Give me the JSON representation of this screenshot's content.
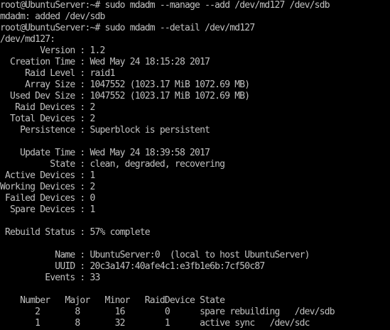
{
  "terminal": {
    "lines": [
      "root@UbuntuServer:~# sudo mdadm --manage --add /dev/md127 /dev/sdb",
      "mdadm: added /dev/sdb",
      "root@UbuntuServer:~# sudo mdadm --detail /dev/md127",
      "/dev/md127:",
      "        Version : 1.2",
      "  Creation Time : Wed May 24 18:15:28 2017",
      "     Raid Level : raid1",
      "     Array Size : 1047552 (1023.17 MiB 1072.69 MB)",
      "  Used Dev Size : 1047552 (1023.17 MiB 1072.69 MB)",
      "   Raid Devices : 2",
      "  Total Devices : 2",
      "    Persistence : Superblock is persistent",
      "",
      "    Update Time : Wed May 24 18:39:58 2017",
      "          State : clean, degraded, recovering",
      " Active Devices : 1",
      "Working Devices : 2",
      " Failed Devices : 0",
      "  Spare Devices : 1",
      "",
      " Rebuild Status : 57% complete",
      "",
      "           Name : UbuntuServer:0  (local to host UbuntuServer)",
      "           UUID : 20c3a147:40afe4c1:e3fb1e6b:7cf50c87",
      "         Events : 33",
      "",
      "    Number   Major   Minor   RaidDevice State",
      "       2       8       16        0      spare rebuilding   /dev/sdb",
      "       1       8       32        1      active sync   /dev/sdc"
    ]
  }
}
